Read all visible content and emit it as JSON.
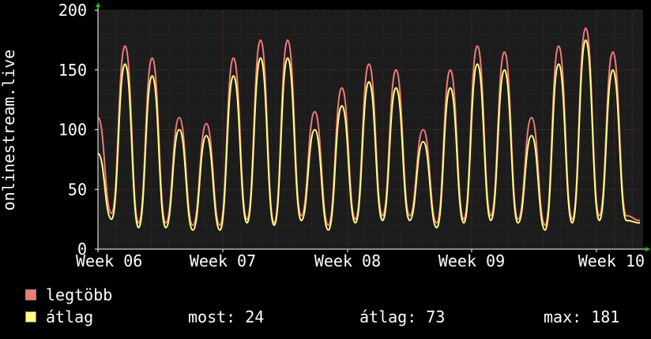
{
  "chart_data": {
    "type": "line",
    "ylabel": "onlinestream.live",
    "ylim": [
      0,
      200
    ],
    "y_ticks": [
      "0",
      "50",
      "100",
      "150",
      "200"
    ],
    "x_tick_labels": [
      "Week 06",
      "Week 07",
      "Week 08",
      "Week 09",
      "Week 10"
    ],
    "grid": true,
    "x": [
      "Week 06 -0.2",
      "Week 06",
      "Week 07",
      "Week 08",
      "Week 09",
      "Week 10"
    ],
    "series": [
      {
        "name": "legtöbb",
        "color": "#f07a7a",
        "values": [
          110,
          30,
          170,
          22,
          160,
          22,
          110,
          20,
          105,
          20,
          160,
          25,
          175,
          22,
          175,
          28,
          115,
          20,
          135,
          25,
          155,
          28,
          150,
          28,
          100,
          22,
          150,
          25,
          170,
          28,
          165,
          25,
          110,
          20,
          170,
          25,
          185,
          28,
          165,
          28,
          24
        ]
      },
      {
        "name": "átlag",
        "color": "#ffff80",
        "values": [
          80,
          25,
          155,
          18,
          145,
          18,
          100,
          16,
          95,
          16,
          145,
          22,
          160,
          20,
          160,
          24,
          100,
          16,
          120,
          22,
          140,
          24,
          135,
          24,
          90,
          18,
          135,
          22,
          155,
          24,
          150,
          22,
          95,
          16,
          155,
          22,
          175,
          24,
          150,
          24,
          22
        ]
      }
    ]
  },
  "legend": {
    "max_label": "legtöbb",
    "avg_label": "átlag",
    "max_color": "#f07a7a",
    "avg_color": "#ffff80"
  },
  "stats": {
    "now": "most: 24",
    "avg": "átlag: 73",
    "max": "max: 181"
  }
}
